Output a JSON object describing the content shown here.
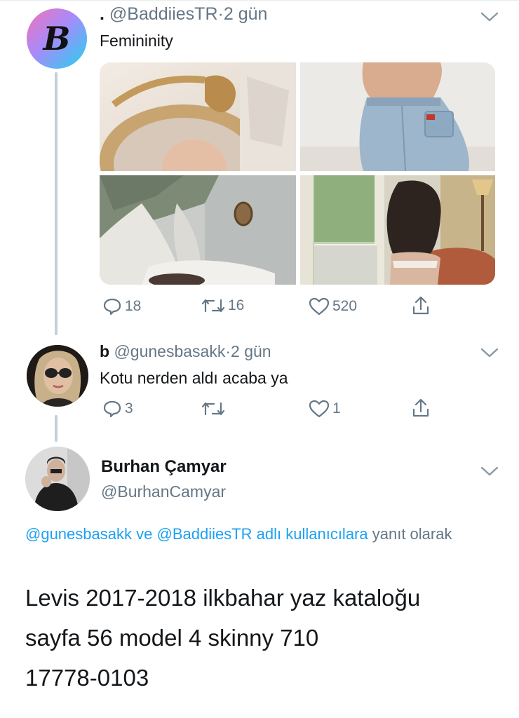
{
  "tweet1": {
    "dot": ".",
    "handle": "@BaddiiesTR",
    "separator": "·",
    "time": "2 gün",
    "avatar_letter": "B",
    "text": "Femininity",
    "reply_count": "18",
    "retweet_count": "16",
    "like_count": "520"
  },
  "tweet2": {
    "display_name": "b",
    "handle": "@gunesbasakk",
    "separator": "·",
    "time": "2 gün",
    "text": "Kotu nerden aldı acaba ya",
    "reply_count": "3",
    "like_count": "1"
  },
  "tweet3": {
    "display_name": "Burhan Çamyar",
    "handle": "@BurhanCamyar",
    "reply_mention_1": "@gunesbasakk",
    "reply_and": "ve",
    "reply_mention_2": "@BaddiiesTR adlı kullanıcılara",
    "reply_suffix": "yanıt olarak",
    "text_line1": "Levis 2017-2018 ilkbahar yaz kataloğu",
    "text_line2": "sayfa 56 model 4 skinny 710",
    "text_line3": "17778-0103"
  },
  "colors": {
    "link": "#1da1f2",
    "secondary": "#657786",
    "thread_line": "#c4cfd6"
  }
}
